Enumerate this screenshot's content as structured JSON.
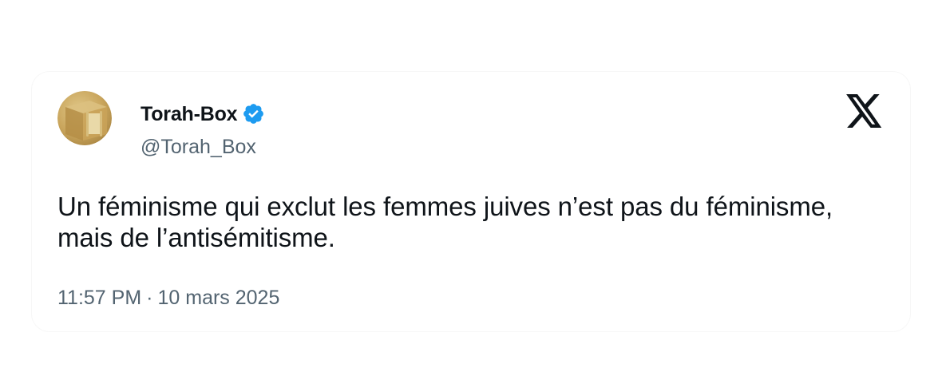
{
  "tweet": {
    "author": {
      "display_name": "Torah-Box",
      "handle": "@Torah_Box",
      "verified": true,
      "avatar_icon": "torah-scroll-box-avatar",
      "verified_badge_color": "#1d9bf0"
    },
    "text": "Un féminisme qui exclut les femmes juives n’est pas du féminisme, mais de l’antisémitisme.",
    "time": "11:57 PM",
    "separator": "·",
    "date": "10 mars 2025",
    "platform_icon": "x-logo-icon"
  },
  "colors": {
    "primary_text": "#0f1419",
    "secondary_text": "#536471",
    "verified_blue": "#1d9bf0",
    "avatar_gold": "#c9a55c"
  }
}
